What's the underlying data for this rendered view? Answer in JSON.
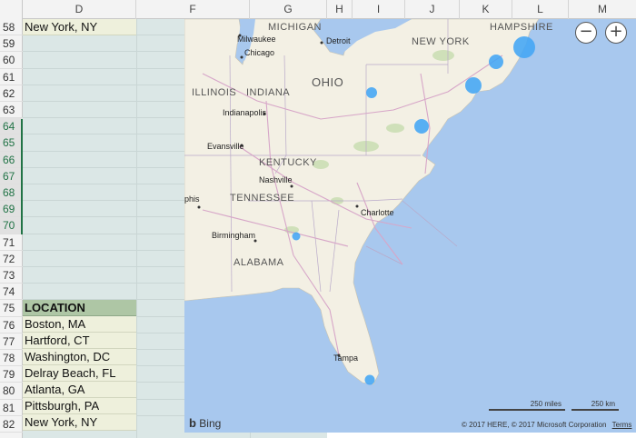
{
  "columns": [
    "D",
    "F",
    "G",
    "H",
    "I",
    "J",
    "K",
    "L",
    "M"
  ],
  "rows": [
    "58",
    "59",
    "60",
    "61",
    "62",
    "63",
    "64",
    "65",
    "66",
    "67",
    "68",
    "69",
    "70",
    "71",
    "72",
    "73",
    "74",
    "75",
    "76",
    "77",
    "78",
    "79",
    "80",
    "81",
    "82"
  ],
  "selected_rows": [
    "64",
    "65",
    "66",
    "67",
    "68",
    "69",
    "70"
  ],
  "cells": {
    "row58": "New York, NY",
    "header": "LOCATION",
    "locations": [
      "Boston, MA",
      "Hartford, CT",
      "Washington, DC",
      "Delray Beach, FL",
      "Atlanta, GA",
      "Pittsburgh, PA",
      "New York, NY"
    ]
  },
  "map": {
    "state_labels": [
      "MICHIGAN",
      "NEW YORK",
      "HAMPSHIRE",
      "OHIO",
      "ILLINOIS",
      "INDIANA",
      "KENTUCKY",
      "TENNESSEE",
      "ALABAMA"
    ],
    "city_labels": [
      "Milwaukee",
      "Chicago",
      "Detroit",
      "Indianapolis",
      "Evansville",
      "Nashville",
      "Charlotte",
      "Birmingham",
      "Tampa",
      "phis"
    ],
    "bubble_color": "#42a5f5",
    "water_color": "#a8c8ee",
    "land_color": "#f3f0e4",
    "zoom_out_symbol": "−",
    "zoom_in_symbol": "+",
    "logo_mark": "b",
    "logo_text": "Bing",
    "scale_miles": "250 miles",
    "scale_km": "250 km",
    "copyright": "© 2017 HERE, © 2017 Microsoft Corporation",
    "terms": "Terms"
  }
}
